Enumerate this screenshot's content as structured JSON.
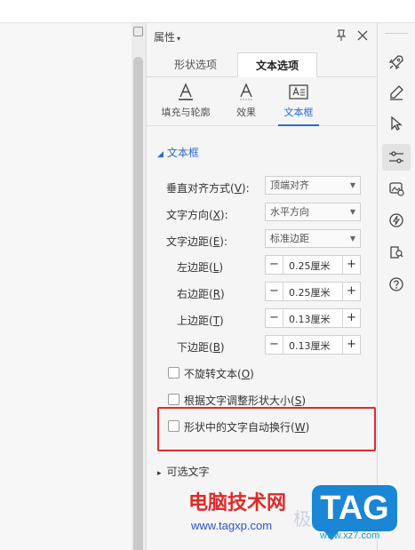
{
  "panel": {
    "title": "属性",
    "title_caret": "▾",
    "tabs": [
      {
        "label": "形状选项",
        "active": false
      },
      {
        "label": "文本选项",
        "active": true
      }
    ],
    "subtabs": [
      {
        "label": "填充与轮廓",
        "icon": "text-fill-icon",
        "active": false
      },
      {
        "label": "效果",
        "icon": "text-effect-icon",
        "active": false
      },
      {
        "label": "文本框",
        "icon": "textbox-icon",
        "active": true
      }
    ]
  },
  "textbox": {
    "section_title": "文本框",
    "vertical_align": {
      "label": "垂直对齐方式(",
      "key": "V",
      "label_end": "):",
      "value": "顶端对齐"
    },
    "text_direction": {
      "label": "文字方向(",
      "key": "X",
      "label_end": "):",
      "value": "水平方向"
    },
    "text_margin": {
      "label": "文字边距(",
      "key": "E",
      "label_end": "):",
      "value": "标准边距"
    },
    "margins": [
      {
        "label": "左边距(",
        "key": "L",
        "label_end": ")",
        "value": "0.25厘米"
      },
      {
        "label": "右边距(",
        "key": "R",
        "label_end": ")",
        "value": "0.25厘米"
      },
      {
        "label": "上边距(",
        "key": "T",
        "label_end": ")",
        "value": "0.13厘米"
      },
      {
        "label": "下边距(",
        "key": "B",
        "label_end": ")",
        "value": "0.13厘米"
      }
    ],
    "checkboxes": [
      {
        "label": "不旋转文本(",
        "key": "O",
        "label_end": ")",
        "checked": false
      },
      {
        "label": "根据文字调整形状大小(",
        "key": "S",
        "label_end": ")",
        "checked": false
      },
      {
        "label": "形状中的文字自动换行(",
        "key": "W",
        "label_end": ")",
        "checked": false
      }
    ],
    "stepper_minus": "−",
    "stepper_plus": "+"
  },
  "alt_text": {
    "label": "可选文字",
    "expand_caret": "▸"
  },
  "watermark": {
    "site_name": "电脑技术网",
    "site_url": "www.tagxp.com",
    "badge": "TAG",
    "url2": "www.xz7.com",
    "faint": "极光下载站"
  },
  "colors": {
    "accent": "#2a6bd6",
    "highlight": "#e02b2b",
    "badge": "#1a86d6"
  }
}
